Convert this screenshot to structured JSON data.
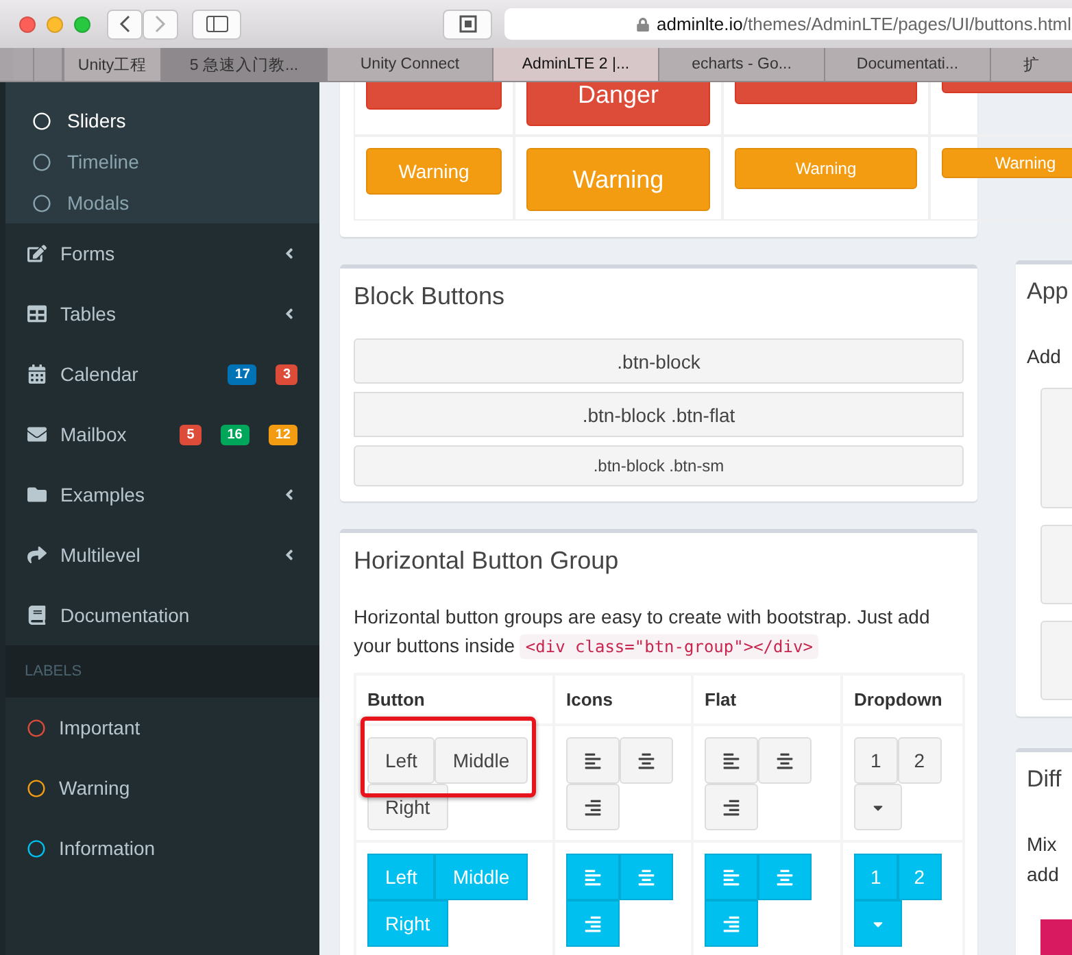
{
  "browser": {
    "url_host": "adminlte.io",
    "url_path": "/themes/AdminLTE/pages/UI/buttons.html",
    "tabs": [
      {
        "label": "Unity工程",
        "selected": false
      },
      {
        "label": "5 急速入门教...",
        "selected": false
      },
      {
        "label": "Unity Connect",
        "selected": false
      },
      {
        "label": "AdminLTE 2 |...",
        "selected": true
      },
      {
        "label": "echarts - Go...",
        "selected": false
      },
      {
        "label": "Documentati...",
        "selected": false
      },
      {
        "label": "扩",
        "selected": false
      }
    ]
  },
  "sidebar": {
    "submenu": [
      {
        "label": "Sliders",
        "selected": true
      },
      {
        "label": "Timeline",
        "selected": false
      },
      {
        "label": "Modals",
        "selected": false
      }
    ],
    "menu": [
      {
        "label": "Forms",
        "expandable": true
      },
      {
        "label": "Tables",
        "expandable": true
      },
      {
        "label": "Calendar",
        "expandable": false,
        "badges": [
          {
            "text": "17",
            "color": "#0073b7"
          },
          {
            "text": "3",
            "color": "#dd4b39"
          }
        ]
      },
      {
        "label": "Mailbox",
        "expandable": false,
        "badges": [
          {
            "text": "5",
            "color": "#dd4b39"
          },
          {
            "text": "16",
            "color": "#00a65a"
          },
          {
            "text": "12",
            "color": "#f39c12"
          }
        ]
      },
      {
        "label": "Examples",
        "expandable": true
      },
      {
        "label": "Multilevel",
        "expandable": true
      },
      {
        "label": "Documentation",
        "expandable": false
      }
    ],
    "labels_header": "LABELS",
    "labels": [
      {
        "label": "Important",
        "color": "#dd4b39"
      },
      {
        "label": "Warning",
        "color": "#f39c12"
      },
      {
        "label": "Information",
        "color": "#00c0ef"
      }
    ]
  },
  "top_table": {
    "rows": [
      {
        "kind": "danger",
        "buttons": [
          {
            "kind": "normal"
          },
          {
            "kind": "large",
            "label": "Danger"
          },
          {
            "kind": "small"
          },
          {
            "kind": "xs"
          }
        ]
      },
      {
        "kind": "warning",
        "buttons": [
          {
            "kind": "normal",
            "label": "Warning"
          },
          {
            "kind": "large",
            "label": "Warning"
          },
          {
            "kind": "small",
            "label": "Warning"
          },
          {
            "kind": "xs",
            "label": "Warning"
          }
        ]
      }
    ]
  },
  "block_buttons": {
    "title": "Block Buttons",
    "buttons": [
      {
        "label": ".btn-block",
        "kind": "normal"
      },
      {
        "label": ".btn-block .btn-flat",
        "kind": "flat"
      },
      {
        "label": ".btn-block .btn-sm",
        "kind": "small"
      }
    ]
  },
  "button_group": {
    "title": "Horizontal Button Group",
    "description": "Horizontal button groups are easy to create with bootstrap. Just add your buttons inside ",
    "code": "<div class=\"btn-group\"></div>",
    "columns": [
      "Button",
      "Icons",
      "Flat",
      "Dropdown"
    ],
    "rows": [
      {
        "kind": "default",
        "highlighted": true,
        "buttons": [
          "Left",
          "Middle",
          "Right"
        ],
        "dropdown": [
          "1",
          "2"
        ]
      },
      {
        "kind": "info",
        "highlighted": false,
        "buttons": [
          "Left",
          "Middle",
          "Right"
        ],
        "dropdown": [
          "1",
          "2"
        ]
      }
    ]
  },
  "right_cards": [
    {
      "title": "App",
      "lines": [
        "Add"
      ]
    },
    {
      "title": "Diff",
      "lines": [
        "Mix",
        "add"
      ]
    }
  ]
}
